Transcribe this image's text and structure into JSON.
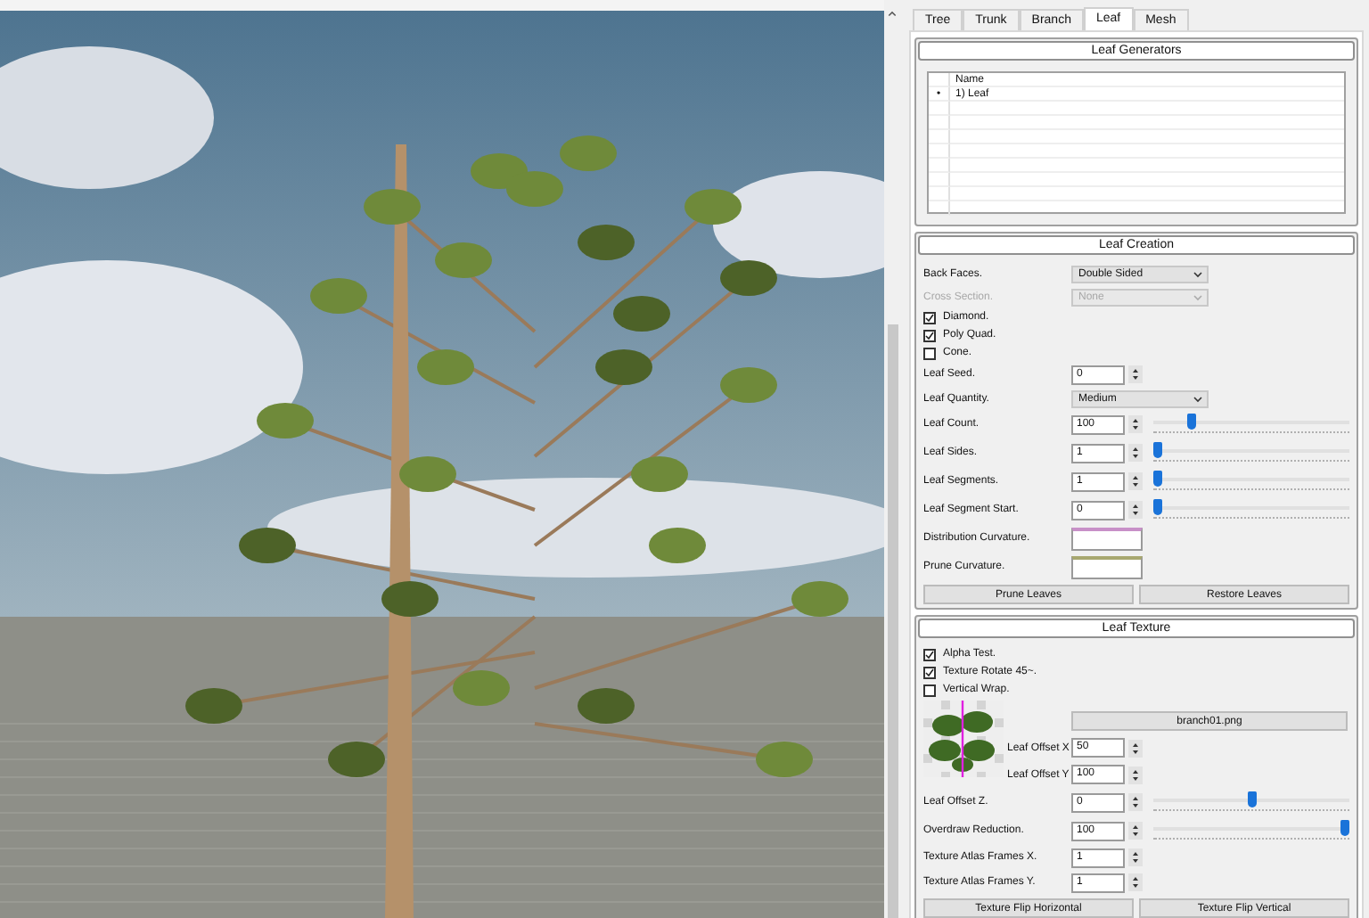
{
  "tabs": [
    {
      "label": "Tree",
      "selected": false
    },
    {
      "label": "Trunk",
      "selected": false
    },
    {
      "label": "Branch",
      "selected": false
    },
    {
      "label": "Leaf",
      "selected": true
    },
    {
      "label": "Mesh",
      "selected": false
    }
  ],
  "leaf_generators": {
    "title": "Leaf Generators",
    "columns": [
      "Name"
    ],
    "rows": [
      {
        "marker": "•",
        "name": "1) Leaf"
      }
    ]
  },
  "leaf_creation": {
    "title": "Leaf Creation",
    "fields": [
      {
        "kind": "select",
        "label": "Back Faces.",
        "value": "Double Sided",
        "disabled": false
      },
      {
        "kind": "select",
        "label": "Cross Section.",
        "value": "None",
        "disabled": true
      },
      {
        "kind": "checkbox",
        "label": "Diamond.",
        "checked": true
      },
      {
        "kind": "checkbox",
        "label": "Poly Quad.",
        "checked": true
      },
      {
        "kind": "checkbox",
        "label": "Cone.",
        "checked": false
      },
      {
        "kind": "spin",
        "label": "Leaf Seed.",
        "value": "0"
      },
      {
        "kind": "select",
        "label": "Leaf Quantity.",
        "value": "Medium",
        "disabled": false
      },
      {
        "kind": "slider",
        "label": "Leaf Count.",
        "value": "100",
        "level": 0.18
      },
      {
        "kind": "slider",
        "label": "Leaf Sides.",
        "value": "1",
        "level": 0
      },
      {
        "kind": "slider",
        "label": "Leaf Segments.",
        "value": "1",
        "level": 0
      },
      {
        "kind": "slider",
        "label": "Leaf Segment Start.",
        "value": "0",
        "level": 0
      },
      {
        "kind": "curve",
        "label": "Distribution Curvature.",
        "color": "#c890c8"
      },
      {
        "kind": "curve",
        "label": "Prune Curvature.",
        "color": "#a8a870"
      }
    ],
    "buttons": [
      "Prune Leaves",
      "Restore Leaves"
    ]
  },
  "leaf_texture": {
    "title": "Leaf Texture",
    "fields": [
      {
        "kind": "checkbox",
        "label": "Alpha Test.",
        "checked": true
      },
      {
        "kind": "checkbox",
        "label": "Texture Rotate 45~.",
        "checked": true
      },
      {
        "kind": "checkbox",
        "label": "Vertical Wrap.",
        "checked": false
      }
    ],
    "texture_button": "branch01.png",
    "offsets": [
      {
        "label": "Leaf Offset X",
        "value": "50"
      },
      {
        "label": "Leaf Offset Y",
        "value": "100"
      }
    ],
    "more_fields": [
      {
        "kind": "slider",
        "label": "Leaf Offset Z.",
        "value": "0",
        "level": 0.5
      },
      {
        "kind": "slider",
        "label": "Overdraw Reduction.",
        "value": "100",
        "level": 1
      },
      {
        "kind": "spin",
        "label": "Texture Atlas Frames X.",
        "value": "1"
      },
      {
        "kind": "spin",
        "label": "Texture Atlas Frames Y.",
        "value": "1"
      }
    ],
    "buttons": [
      "Texture Flip Horizontal",
      "Texture Flip Vertical"
    ]
  }
}
